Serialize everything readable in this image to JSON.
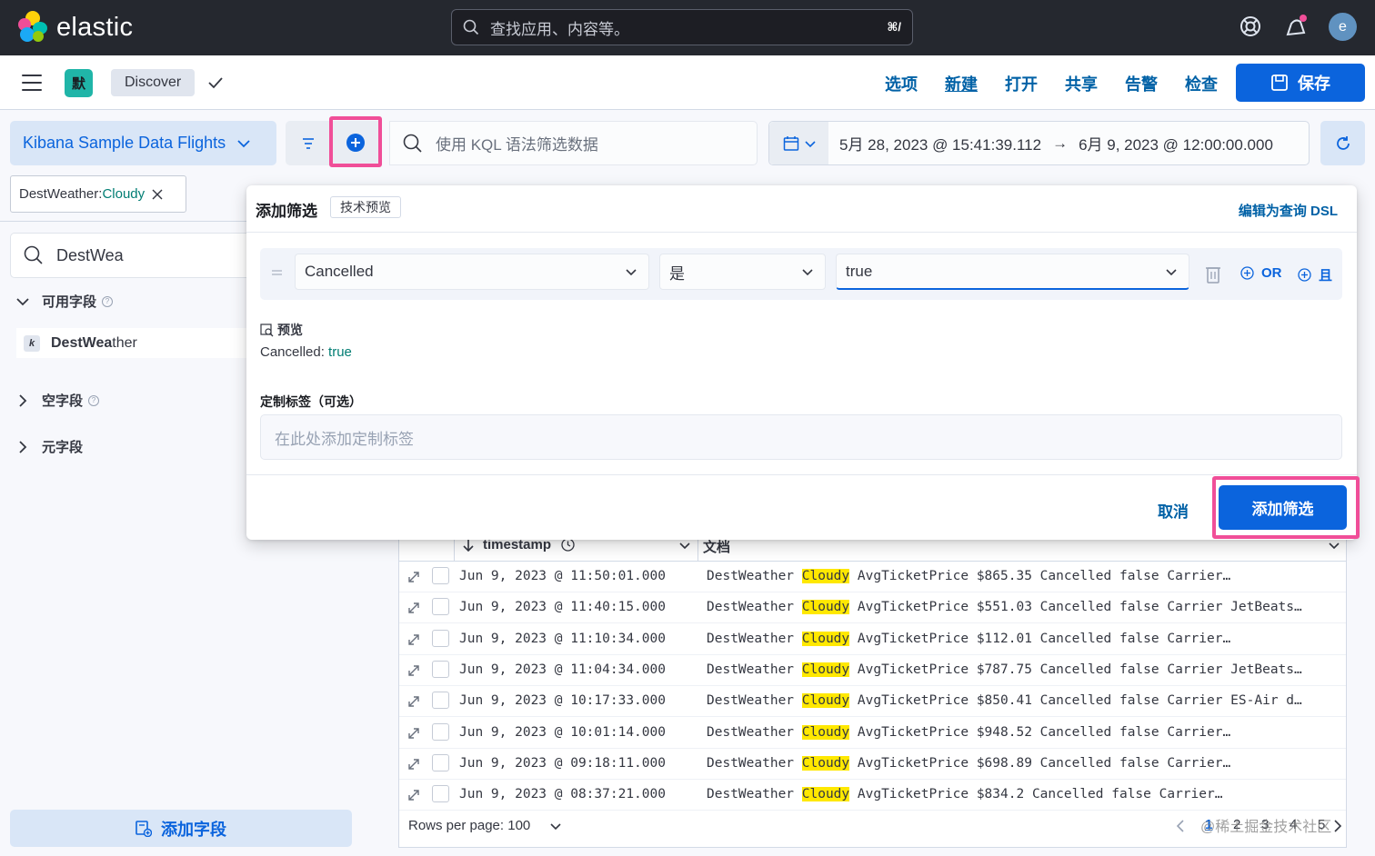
{
  "header": {
    "brand": "elastic",
    "search_placeholder": "查找应用、内容等。",
    "search_shortcut": "⌘/",
    "avatar_initial": "e"
  },
  "appbar": {
    "space_initial": "默",
    "breadcrumb": "Discover",
    "menu": [
      "选项",
      "新建",
      "打开",
      "共享",
      "告警",
      "检查"
    ],
    "save_label": "保存"
  },
  "query": {
    "data_view": "Kibana Sample Data Flights",
    "kql_placeholder": "使用 KQL 语法筛选数据",
    "start_date": "5月 28, 2023 @ 15:41:39.112",
    "arrow": "→",
    "end_date": "6月 9, 2023 @ 12:00:00.000"
  },
  "filter_pill": {
    "field": "DestWeather: ",
    "value": "Cloudy"
  },
  "sidebar": {
    "search_value": "DestWea",
    "available_title": "可用字段",
    "field_match": "DestWea",
    "field_rest": "ther",
    "field_token": "k",
    "empty_title": "空字段",
    "meta_title": "元字段",
    "add_field_label": "添加字段"
  },
  "flyout": {
    "title": "添加筛选",
    "badge": "技术预览",
    "dsl_link": "编辑为查询 DSL",
    "field_select": "Cancelled",
    "operator_select": "是",
    "value_select": "true",
    "or_label": "OR",
    "and_label": "且",
    "preview_label": "预览",
    "preview_field": "Cancelled: ",
    "preview_value": "true",
    "custom_label_title": "定制标签（可选）",
    "custom_label_placeholder": "在此处添加定制标签",
    "cancel_label": "取消",
    "submit_label": "添加筛选"
  },
  "table": {
    "col_timestamp": "timestamp",
    "col_document": "文档",
    "rows": [
      {
        "ts": "Jun 9, 2023 @ 11:50:01.000",
        "pre": "DestWeather ",
        "hl": "Cloudy",
        "post": " AvgTicketPrice $865.35 Cancelled false Carrier…"
      },
      {
        "ts": "Jun 9, 2023 @ 11:40:15.000",
        "pre": "DestWeather ",
        "hl": "Cloudy",
        "post": " AvgTicketPrice $551.03 Cancelled false Carrier JetBeats…"
      },
      {
        "ts": "Jun 9, 2023 @ 11:10:34.000",
        "pre": "DestWeather ",
        "hl": "Cloudy",
        "post": " AvgTicketPrice $112.01 Cancelled false Carrier…"
      },
      {
        "ts": "Jun 9, 2023 @ 11:04:34.000",
        "pre": "DestWeather ",
        "hl": "Cloudy",
        "post": " AvgTicketPrice $787.75 Cancelled false Carrier JetBeats…"
      },
      {
        "ts": "Jun 9, 2023 @ 10:17:33.000",
        "pre": "DestWeather ",
        "hl": "Cloudy",
        "post": " AvgTicketPrice $850.41 Cancelled false Carrier ES-Air d…"
      },
      {
        "ts": "Jun 9, 2023 @ 10:01:14.000",
        "pre": "DestWeather ",
        "hl": "Cloudy",
        "post": " AvgTicketPrice $948.52 Cancelled false Carrier…"
      },
      {
        "ts": "Jun 9, 2023 @ 09:18:11.000",
        "pre": "DestWeather ",
        "hl": "Cloudy",
        "post": " AvgTicketPrice $698.89 Cancelled false Carrier…"
      },
      {
        "ts": "Jun 9, 2023 @ 08:37:21.000",
        "pre": "DestWeather ",
        "hl": "Cloudy",
        "post": " AvgTicketPrice $834.2 Cancelled false Carrier…"
      }
    ],
    "rows_per_page": "Rows per page: 100",
    "pages": [
      "1",
      "2",
      "3",
      "4",
      "5"
    ]
  },
  "watermark": "@稀土掘金技术社区",
  "colors": {
    "accent": "#0b64dd",
    "highlight_border": "#f04e98",
    "match_highlight": "#ffe800",
    "value_green": "#017d73"
  }
}
